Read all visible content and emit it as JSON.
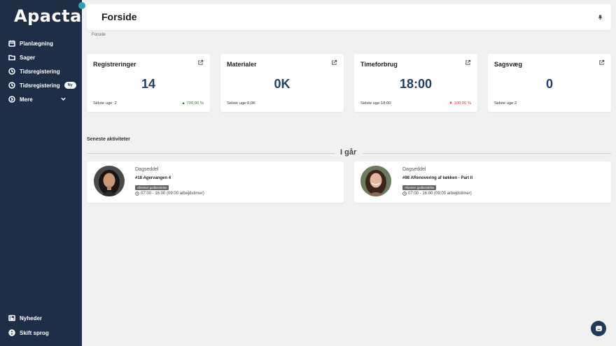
{
  "sidebar": {
    "logo": "Apacta",
    "items": [
      {
        "label": "Planlægning",
        "icon": "calendar-icon"
      },
      {
        "label": "Sager",
        "icon": "folder-icon"
      },
      {
        "label": "Tidsregistering",
        "icon": "clock-icon"
      },
      {
        "label": "Tidsregistering",
        "icon": "clock-icon",
        "badge": "Ny"
      },
      {
        "label": "Mere",
        "icon": "arrow-circle-icon"
      }
    ],
    "bottom": [
      {
        "label": "Nyheder",
        "icon": "newspaper-icon"
      },
      {
        "label": "Skift sprog",
        "icon": "globe-icon"
      }
    ]
  },
  "header": {
    "title": "Forside"
  },
  "breadcrumb": "Forside",
  "cards": [
    {
      "title": "Registreringer",
      "value": "14",
      "footer": "Sidste uge: 2",
      "change": "▲ 700,00 %",
      "direction": "up"
    },
    {
      "title": "Materialer",
      "value": "0K",
      "footer": "Sidste uge:0,0K",
      "change": "",
      "direction": ""
    },
    {
      "title": "Timeforbrug",
      "value": "18:00",
      "footer": "Sidste uge:18:00",
      "change": "▼ 100,00 %",
      "direction": "down"
    },
    {
      "title": "Sagsvæg",
      "value": "0",
      "footer": "Sidste uge:2",
      "change": "",
      "direction": ""
    }
  ],
  "activity": {
    "section_label": "Seneste aktiviteter",
    "day_label": "I går",
    "items": [
      {
        "type": "Dagseddel",
        "title": "#18 Agervangen 4",
        "status": "Afventer godkendelse",
        "time": "07:00 - 16:00 (09:00 arbejdstimer)"
      },
      {
        "type": "Dagseddel",
        "title": "#98 ARenovering af køkken - Part II",
        "status": "Afventer godkendelse",
        "time": "07:00 - 16:00 (09:00 arbejdstimer)"
      }
    ]
  },
  "colors": {
    "sidebar_bg": "#1f2d47",
    "accent": "#1f3f6a",
    "page_bg": "#f1f1f1"
  }
}
